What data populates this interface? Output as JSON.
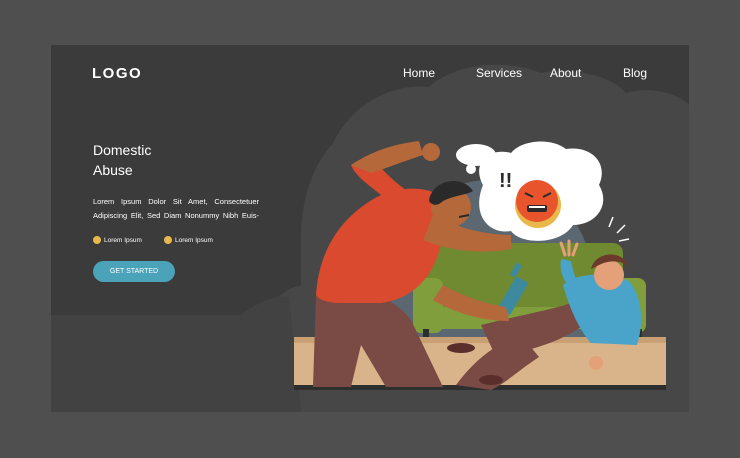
{
  "header": {
    "logo": "LOGO",
    "nav": [
      {
        "label": "Home"
      },
      {
        "label": "Services"
      },
      {
        "label": "About"
      },
      {
        "label": "Blog"
      }
    ]
  },
  "hero": {
    "title_line1": "Domestic",
    "title_line2": "Abuse",
    "body_line1": "Lorem Ipsum Dolor Sit Amet, Consectetuer",
    "body_line2": "Adipiscing Elit, Sed Diam Nonummy Nibh Euis-",
    "bullets": [
      {
        "label": "Lorem Ipsum"
      },
      {
        "label": "Lorem Ipsum"
      }
    ],
    "cta_label": "GET STARTED"
  },
  "illustration": {
    "bubble_text": "!!",
    "colors": {
      "frame_bg": "#3b3b3b",
      "cloud": "#4a4a4a",
      "arch": "#5e6a73",
      "sofa": "#7f9a3a",
      "floor": "#d9b48a",
      "man_shirt": "#d94a2e",
      "man_pants": "#7a4a44",
      "woman_top": "#4aa3c8",
      "emoji": "#e8542c",
      "accent": "#e8b84a",
      "button": "#4aa3b8"
    }
  }
}
